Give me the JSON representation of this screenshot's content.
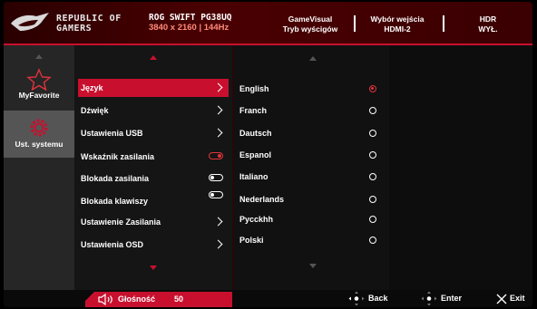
{
  "header": {
    "brand_line1": "REPUBLIC OF",
    "brand_line2": "GAMERS",
    "model": "ROG SWIFT PG38UQ",
    "resolution": "3840 x 2160 | 144Hz",
    "info": [
      {
        "line1": "GameVisual",
        "line2": "Tryb wyścigów"
      },
      {
        "line1": "Wybór wejścia",
        "line2": "HDMI-2"
      },
      {
        "line1": "HDR",
        "line2": "WYŁ."
      }
    ]
  },
  "categories": [
    {
      "label": "MyFavorite",
      "icon": "star-icon",
      "active": false
    },
    {
      "label": "Ust. systemu",
      "icon": "gear-icon",
      "active": true
    }
  ],
  "menu": [
    {
      "label": "Język",
      "control": "chevron",
      "active": true
    },
    {
      "label": "Dźwięk",
      "control": "chevron",
      "active": false
    },
    {
      "label": "Ustawienia USB",
      "control": "chevron",
      "active": false
    },
    {
      "label": "Wskaźnik zasilania",
      "control": "toggle-on",
      "active": false
    },
    {
      "label": "Blokada zasilania",
      "control": "toggle-off",
      "active": false
    },
    {
      "label": "Blokada klawiszy",
      "control": "toggle-off",
      "active": false
    },
    {
      "label": "Ustawienie Zasilania",
      "control": "chevron",
      "active": false
    },
    {
      "label": "Ustawienia OSD",
      "control": "chevron",
      "active": false
    }
  ],
  "languages": [
    {
      "label": "English",
      "selected": true
    },
    {
      "label": "Franch",
      "selected": false
    },
    {
      "label": "Dautsch",
      "selected": false
    },
    {
      "label": "Espanol",
      "selected": false
    },
    {
      "label": "Italiano",
      "selected": false
    },
    {
      "label": "Nederlands",
      "selected": false
    },
    {
      "label": "Pycckhh",
      "selected": false
    },
    {
      "label": "Polski",
      "selected": false
    }
  ],
  "footer": {
    "volume_label": "Głośność",
    "volume_value": "50",
    "back_label": "Back",
    "enter_label": "Enter",
    "exit_label": "Exit"
  },
  "colors": {
    "accent": "#c8102e",
    "selected": "#e0333c"
  }
}
